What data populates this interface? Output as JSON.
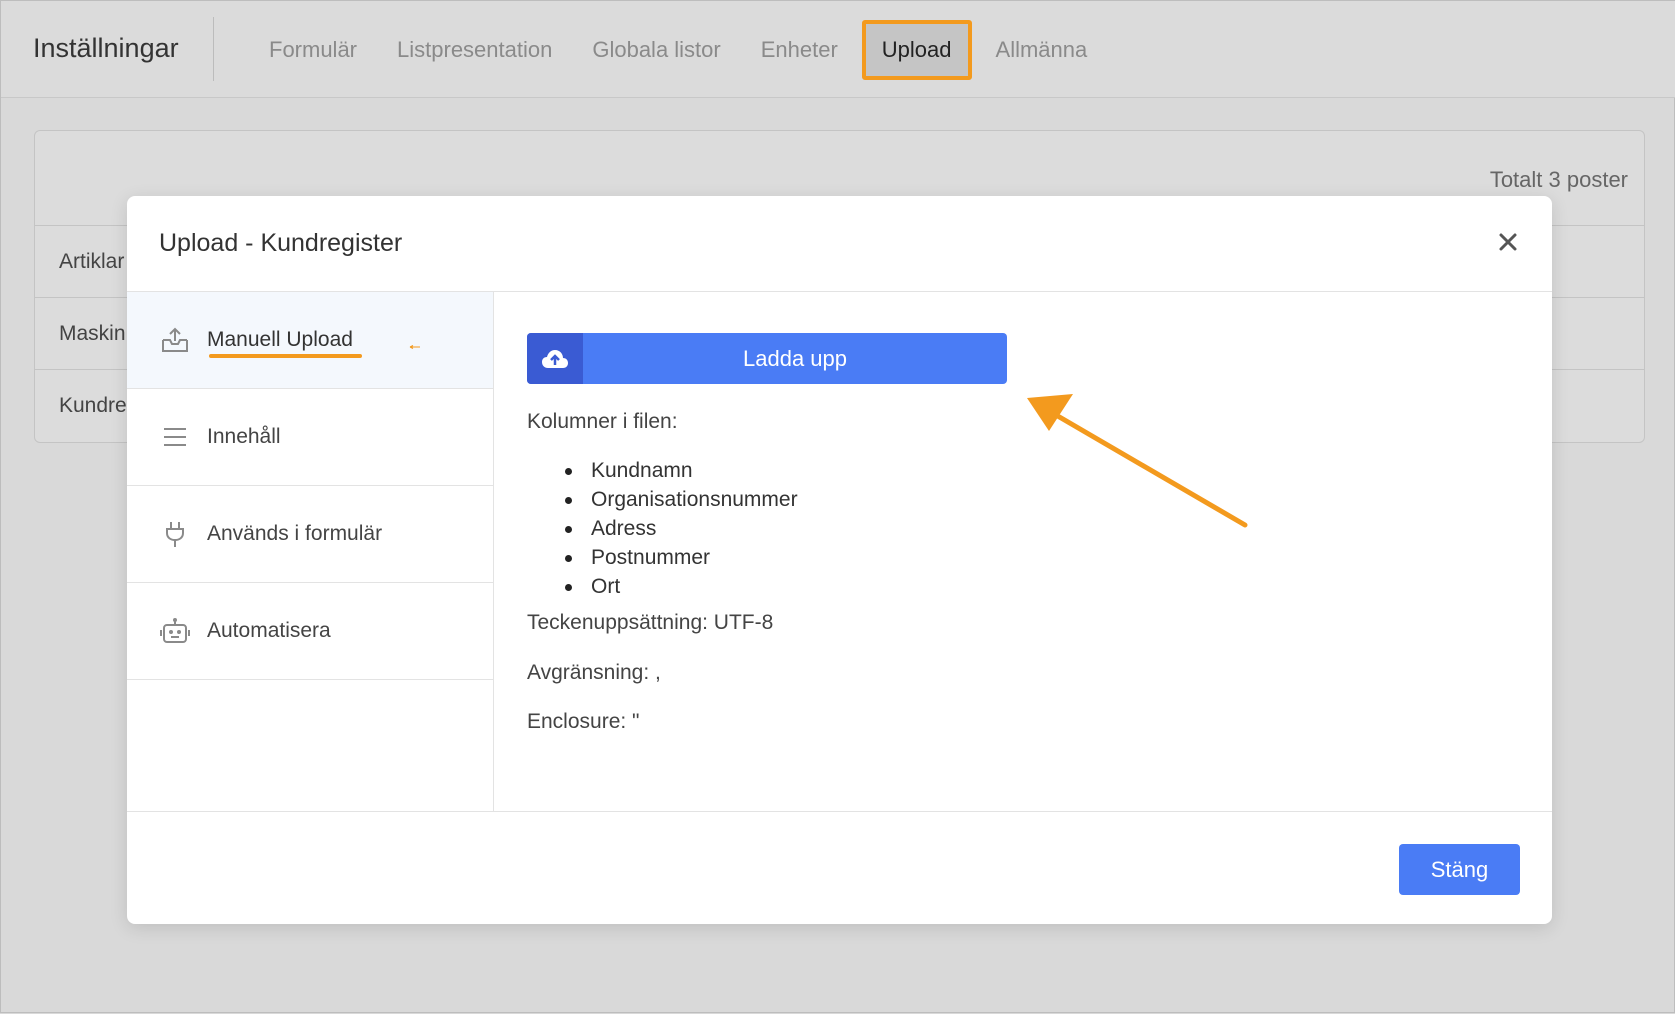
{
  "header": {
    "title": "Inställningar",
    "tabs": [
      {
        "label": "Formulär"
      },
      {
        "label": "Listpresentation"
      },
      {
        "label": "Globala listor"
      },
      {
        "label": "Enheter"
      },
      {
        "label": "Upload"
      },
      {
        "label": "Allmänna"
      }
    ],
    "active_tab": "Upload"
  },
  "background_card": {
    "total": "Totalt 3 poster",
    "rows": [
      "Artiklar",
      "Maskin",
      "Kundre"
    ]
  },
  "modal": {
    "title": "Upload - Kundregister",
    "sidebar": [
      {
        "label": "Manuell Upload",
        "icon": "upload-tray-icon"
      },
      {
        "label": "Innehåll",
        "icon": "list-icon"
      },
      {
        "label": "Används i formulär",
        "icon": "plug-icon"
      },
      {
        "label": "Automatisera",
        "icon": "robot-icon"
      }
    ],
    "active_item": "Manuell Upload",
    "upload_button": "Ladda upp",
    "columns_heading": "Kolumner i filen:",
    "columns": [
      "Kundnamn",
      "Organisationsnummer",
      "Adress",
      "Postnummer",
      "Ort"
    ],
    "encoding": "Teckenuppsättning: UTF-8",
    "delimiter": "Avgränsning: ,",
    "enclosure": "Enclosure: \"",
    "footer_button": "Stäng"
  },
  "colors": {
    "accent": "#4a7cf5",
    "accent_dark": "#3a5bd3",
    "highlight": "#f39a1e"
  }
}
